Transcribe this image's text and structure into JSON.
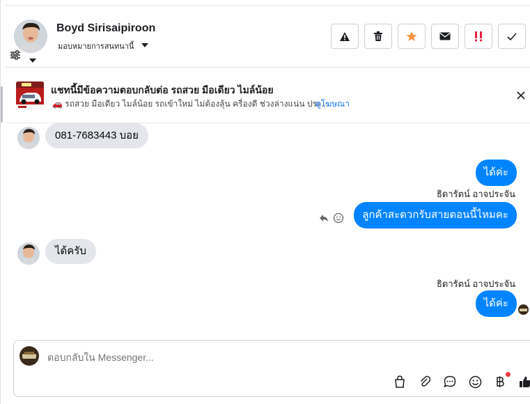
{
  "header": {
    "name": "Boyd Sirisaipiroon",
    "assign_label": "มอบหมายการสนทนานี้",
    "actions": [
      "spam-icon",
      "trash-icon",
      "star-icon",
      "mail-icon",
      "priority-icon",
      "check-icon"
    ],
    "star_color": "#f7923b",
    "priority_color": "#e41e3f"
  },
  "ad": {
    "title": "แชทนี้มีข้อความตอบกลับต่อ รถสวย มือเดียว ไมล์น้อย",
    "description": "🚗 รถสวย มือเดียว ไมล์น้อย รถเข้าใหม่ ไม่ต้องลุ้น ครื่องดี ช่วงล่างแน่น ประ...",
    "link": "ดูโฆษณา"
  },
  "messages": {
    "m1": "081-7683443 บอย",
    "m2": "ได้ค่ะ",
    "sender1": "ธิดารัตน์ อาจประจัน",
    "m3": "ลูกค้าสะดวกรับสายตอนนี้ไหมคะ",
    "m4": "ได้ครับ",
    "sender2": "ธิดารัตน์ อาจประจัน",
    "m5": "ได้ค่ะ"
  },
  "composer": {
    "placeholder": "ตอบกลับใน Messenger...",
    "tools": [
      "bag-icon",
      "attachment-icon",
      "chat-bubble-icon",
      "emoji-icon",
      "baht-icon",
      "like-icon"
    ]
  },
  "colors": {
    "outgoing_bubble": "#0084ff",
    "incoming_bubble": "#e4e6eb",
    "link": "#1877f2"
  }
}
